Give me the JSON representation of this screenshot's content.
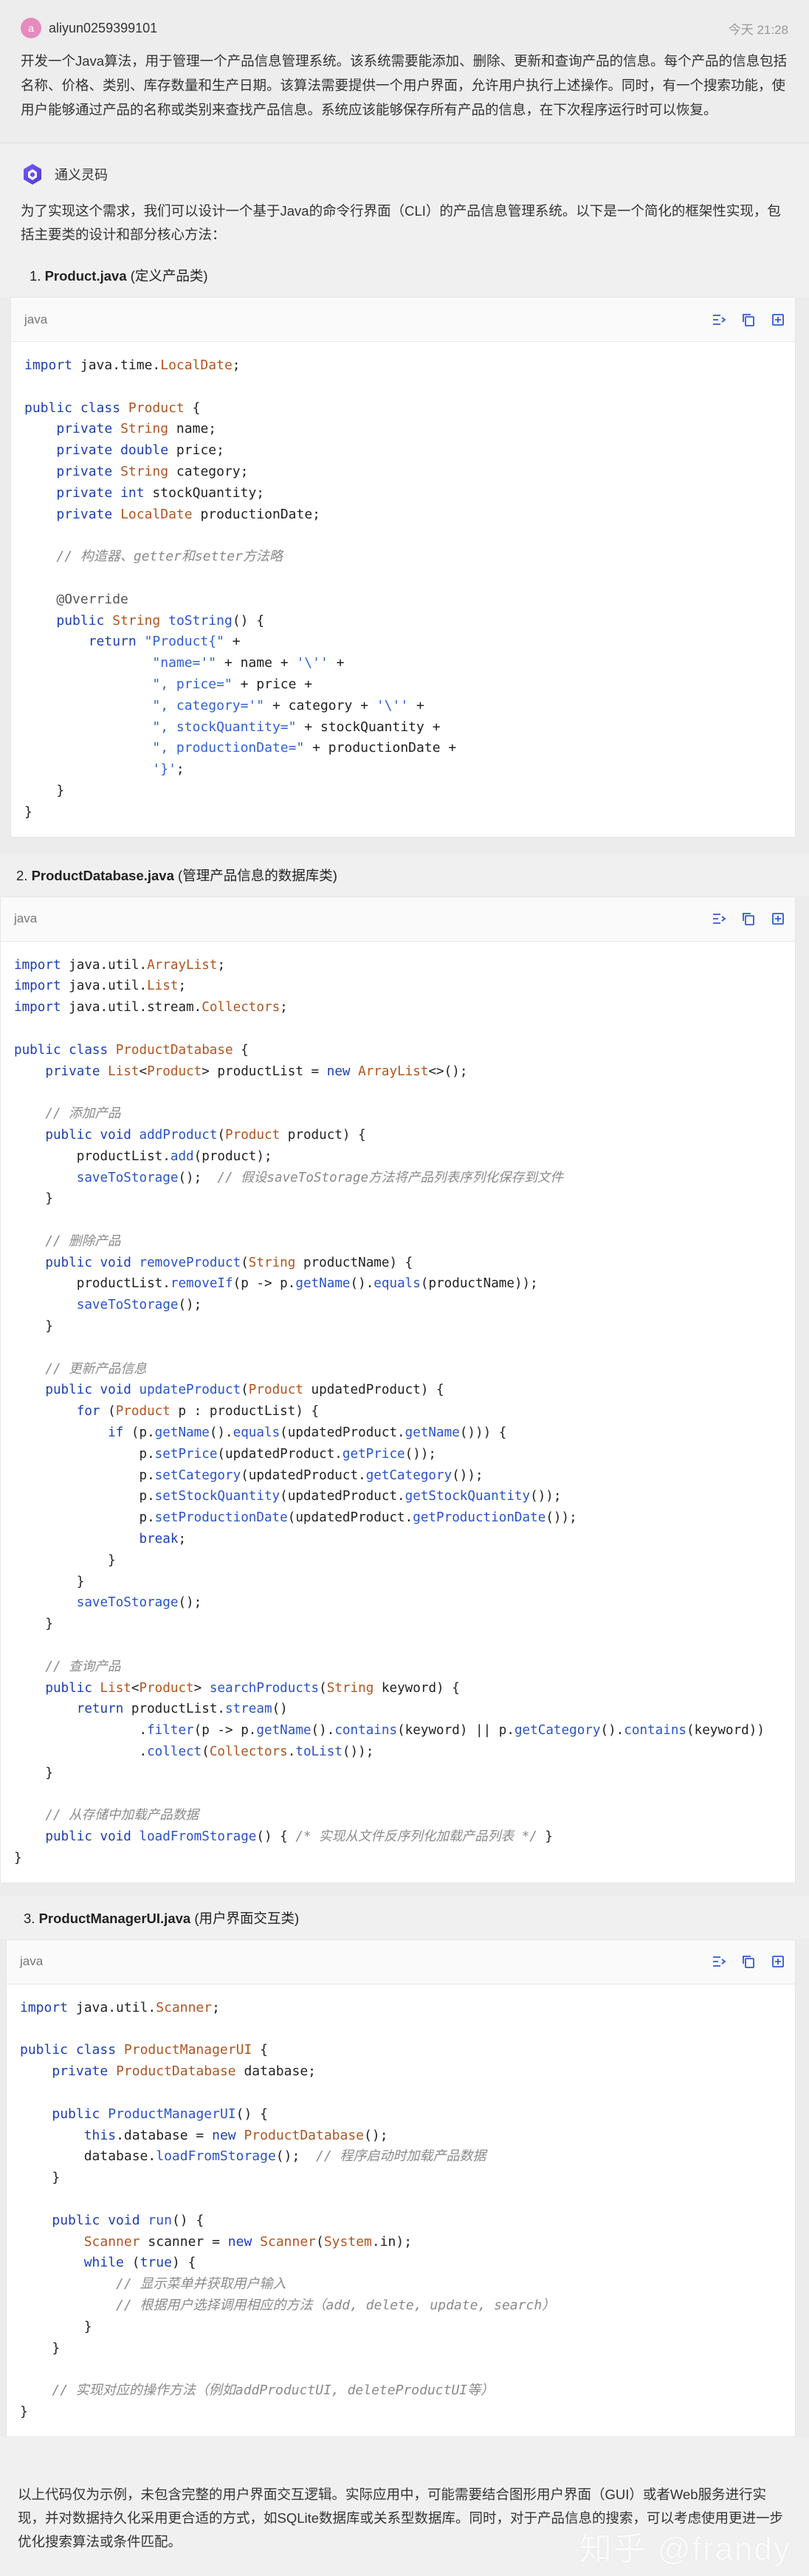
{
  "user": {
    "avatar_letter": "a",
    "name": "aliyun0259399101",
    "time": "今天 21:28",
    "message": "开发一个Java算法，用于管理一个产品信息管理系统。该系统需要能添加、删除、更新和查询产品的信息。每个产品的信息包括名称、价格、类别、库存数量和生产日期。该算法需要提供一个用户界面，允许用户执行上述操作。同时，有一个搜索功能，使用户能够通过产品的名称或类别来查找产品信息。系统应该能够保存所有产品的信息，在下次程序运行时可以恢复。"
  },
  "assistant": {
    "name": "通义灵码",
    "intro": "为了实现这个需求，我们可以设计一个基于Java的命令行界面（CLI）的产品信息管理系统。以下是一个简化的框架性实现，包括主要类的设计和部分核心方法："
  },
  "sections": [
    {
      "num": "1.",
      "file": "Product.java",
      "desc": "(定义产品类)",
      "lang": "java"
    },
    {
      "num": "2.",
      "file": "ProductDatabase.java",
      "desc": "(管理产品信息的数据库类)",
      "lang": "java"
    },
    {
      "num": "3.",
      "file": "ProductManagerUI.java",
      "desc": "(用户界面交互类)",
      "lang": "java"
    }
  ],
  "footer": {
    "text": "以上代码仅为示例，未包含完整的用户界面交互逻辑。实际应用中，可能需要结合图形用户界面（GUI）或者Web服务进行实现，并对数据持久化采用更合适的方式，如SQLite数据库或关系型数据库。同时，对于产品信息的搜索，可以考虑使用更进一步优化搜索算法或条件匹配。",
    "watermark": "知乎 @frandy"
  },
  "icons": [
    "wrap-icon",
    "copy-icon",
    "insert-icon"
  ],
  "colors": {
    "accent": "#2f5bd6",
    "keyword": "#1b3fb4",
    "type": "#b3541e",
    "comment": "#8a8a8a"
  }
}
